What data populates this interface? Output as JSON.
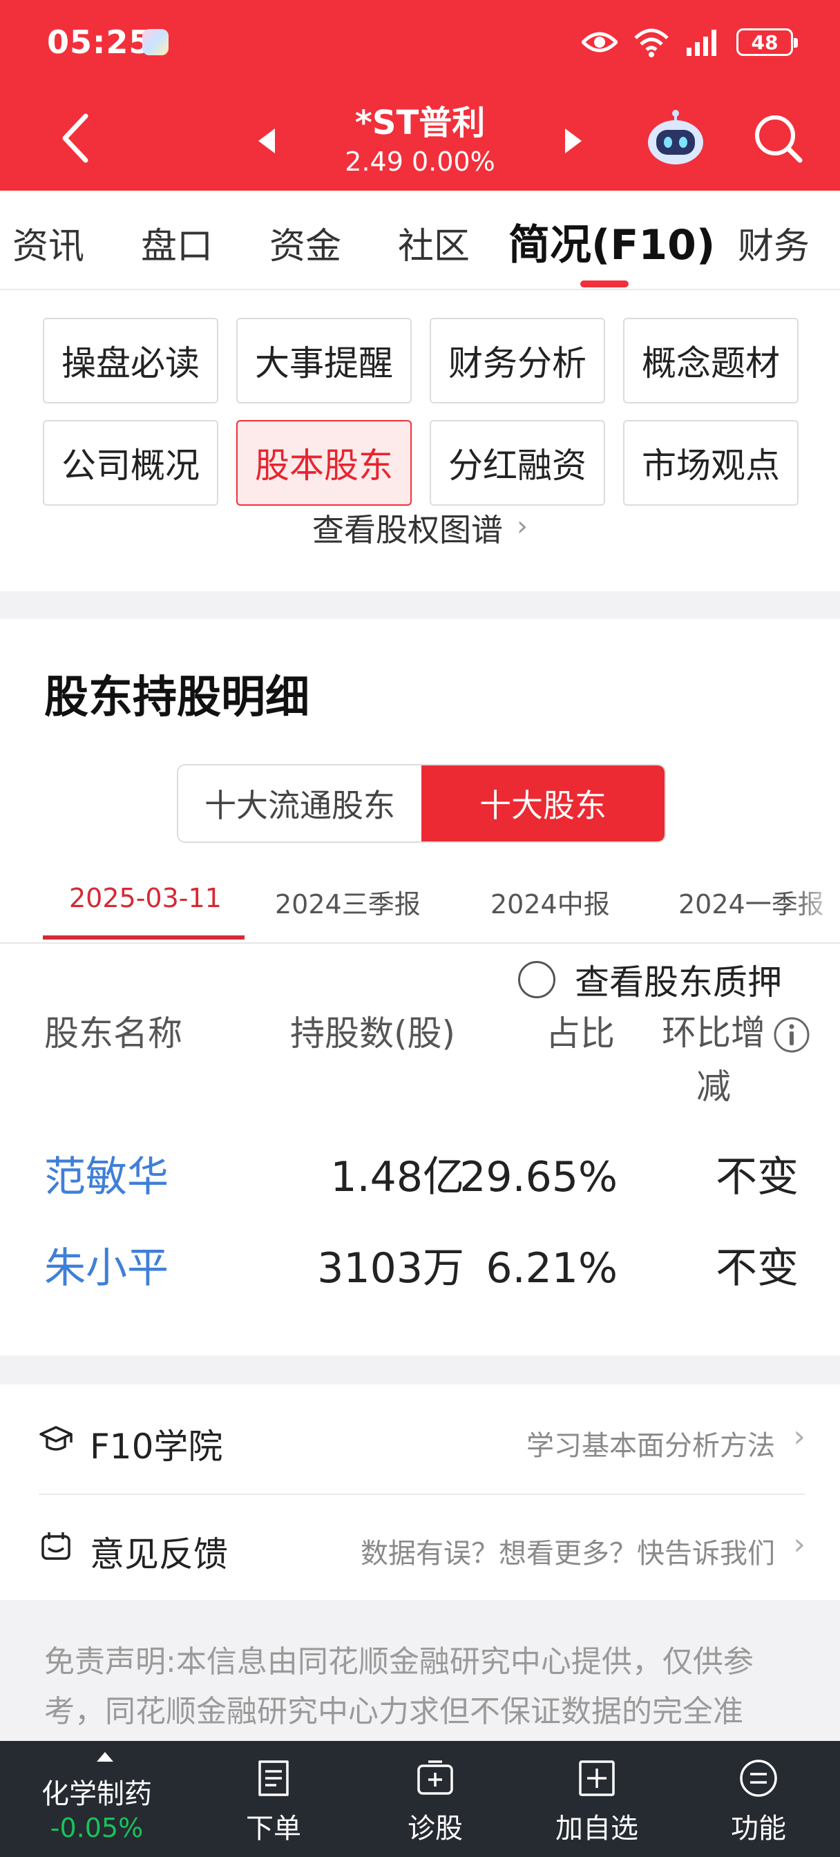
{
  "status_bar": {
    "time": "05:25",
    "battery": "48"
  },
  "header": {
    "stock_name": "*ST普利",
    "price_line": "2.49 0.00%"
  },
  "main_tabs": [
    {
      "label": "资讯"
    },
    {
      "label": "盘口"
    },
    {
      "label": "资金"
    },
    {
      "label": "社区"
    },
    {
      "label": "简况(F10)"
    },
    {
      "label": "财务"
    }
  ],
  "sub_nav": [
    {
      "label": "操盘必读"
    },
    {
      "label": "大事提醒"
    },
    {
      "label": "财务分析"
    },
    {
      "label": "概念题材"
    },
    {
      "label": "公司概况"
    },
    {
      "label": "股本股东"
    },
    {
      "label": "分红融资"
    },
    {
      "label": "市场观点"
    }
  ],
  "equity_link": "查看股权图谱",
  "holdings": {
    "title": "股东持股明细",
    "segments": [
      {
        "label": "十大流通股东"
      },
      {
        "label": "十大股东"
      }
    ],
    "periods": [
      {
        "label": "2025-03-11"
      },
      {
        "label": "2024三季报"
      },
      {
        "label": "2024中报"
      },
      {
        "label": "2024一季报"
      }
    ],
    "pledge_label": "查看股东质押",
    "columns": {
      "name": "股东名称",
      "shares": "持股数(股)",
      "ratio": "占比",
      "change": "环比增减"
    },
    "rows": [
      {
        "name": "范敏华",
        "shares": "1.48亿",
        "ratio": "29.65%",
        "change": "不变"
      },
      {
        "name": "朱小平",
        "shares": "3103万",
        "ratio": "6.21%",
        "change": "不变"
      }
    ]
  },
  "links": [
    {
      "icon": "graduation-cap-icon",
      "title": "F10学院",
      "desc": "学习基本面分析方法"
    },
    {
      "icon": "feedback-icon",
      "title": "意见反馈",
      "desc": "数据有误？想看更多？快告诉我们"
    }
  ],
  "disclaimer": "免责声明:本信息由同花顺金融研究中心提供，仅供参考，同花顺金融研究中心力求但不保证数据的完全准",
  "bottom_bar": {
    "sector_name": "化学制药",
    "sector_change": "-0.05%",
    "items": [
      {
        "label": "下单"
      },
      {
        "label": "诊股"
      },
      {
        "label": "加自选"
      },
      {
        "label": "功能"
      }
    ]
  },
  "colors": {
    "brand_red": "#f2303b",
    "link_blue": "#3f7fd8",
    "down_green": "#19c25a",
    "dark_bar": "#262a31"
  }
}
